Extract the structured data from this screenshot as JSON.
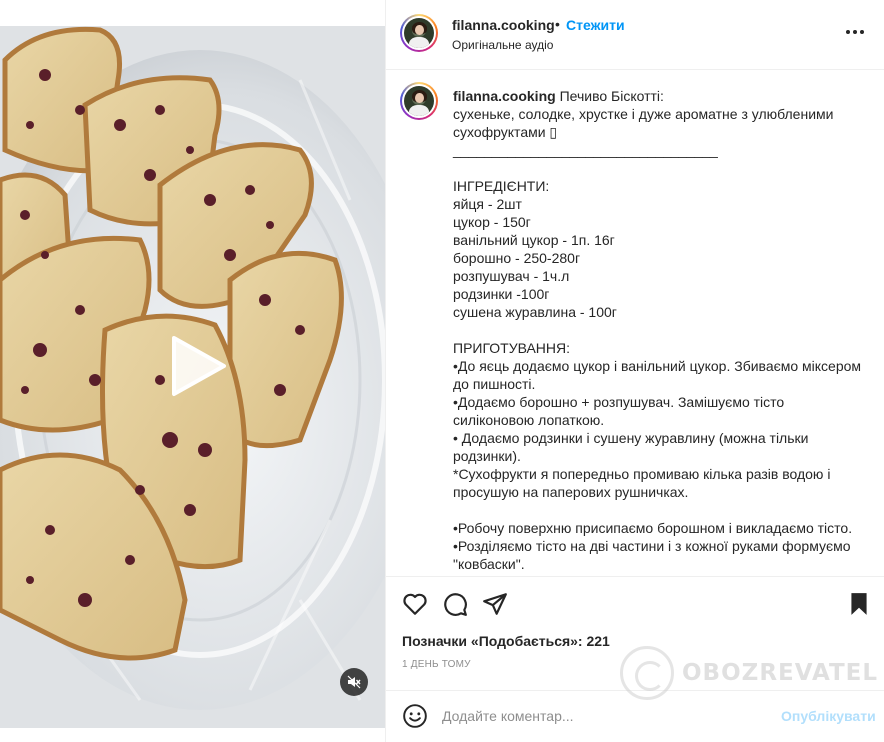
{
  "post": {
    "username": "filanna.cooking",
    "separator": "•",
    "follow_label": "Стежити",
    "audio_label": "Оригінальне аудіо",
    "more_icon": "more-horizontal-icon"
  },
  "caption": {
    "username": "filanna.cooking",
    "text": " Печиво Біскотті:\nсухеньке, солодке, хрустке і дуже ароматне з улюбленими сухофруктами ▯\n__________________________________\n\nІНГРЕДІЄНТИ:\nяйця - 2шт\nцукор - 150г\nванільний цукор - 1п. 16г\nборошно - 250-280г\nрозпушувач - 1ч.л\nродзинки -100г\nсушена журавлина - 100г\n\nПРИГОТУВАННЯ:\n•До яєць додаємо цукор і ванільний цукор. Збиваємо міксером до пишності.\n•Додаємо борошно + розпушувач. Замішуємо тісто силіконовою лопаткою.\n• Додаємо родзинки і сушену журавлину (можна тільки родзинки).\n*Сухофрукти я попередньо промиваю кілька разів водою і просушую на паперових рушничках.\n\n•Робочу поверхню присипаємо борошном і викладаємо тісто.\n•Розділяємо тісто на дві частини і з кожної руками формуємо \"ковбаски\"."
  },
  "actions": {
    "like_icon": "heart-icon",
    "comment_icon": "comment-icon",
    "share_icon": "send-icon",
    "save_icon": "bookmark-icon"
  },
  "likes": {
    "label": "Позначки «Подобається»: 221"
  },
  "time_label": "1 день тому",
  "comment": {
    "placeholder": "Додайте коментар...",
    "publish_label": "Опублікувати",
    "emoji_icon": "emoji-icon"
  },
  "media": {
    "play_icon": "play-icon",
    "mute_icon": "muted-speaker-icon"
  },
  "watermark": {
    "text": "OBOZREVATEL"
  },
  "colors": {
    "accent": "#0095f6",
    "publish_disabled": "#b2dffc",
    "text": "#262626",
    "muted": "#8e8e8e"
  }
}
